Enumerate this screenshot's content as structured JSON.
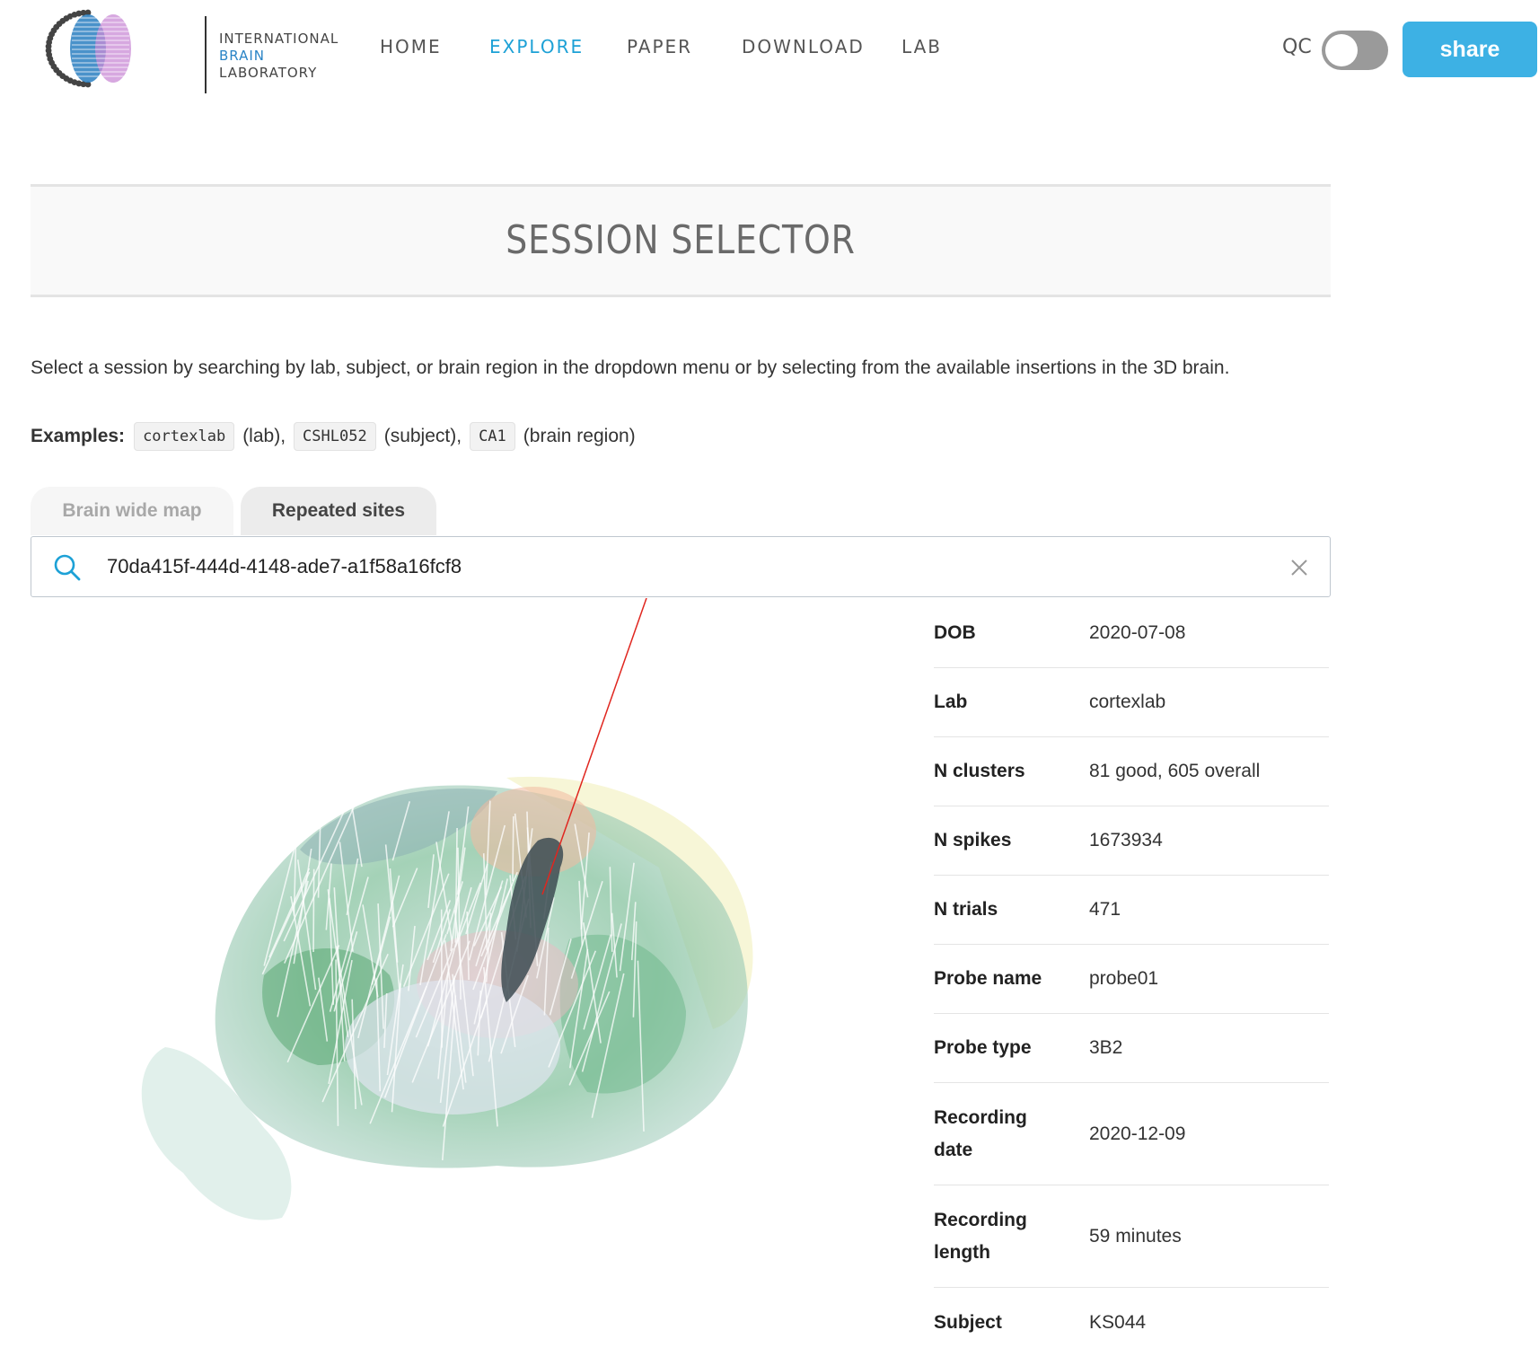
{
  "logo": {
    "line1": "INTERNATIONAL",
    "line2": "BRAIN",
    "line3": "LABORATORY"
  },
  "nav": {
    "items": [
      {
        "label": "HOME",
        "active": false
      },
      {
        "label": "EXPLORE",
        "active": true
      },
      {
        "label": "PAPER",
        "active": false
      },
      {
        "label": "DOWNLOAD",
        "active": false
      },
      {
        "label": "LAB",
        "active": false
      }
    ]
  },
  "header_controls": {
    "qc_label": "QC",
    "qc_enabled": false,
    "share_label": "share"
  },
  "page": {
    "title": "SESSION SELECTOR",
    "description": "Select a session by searching by lab, subject, or brain region in the dropdown menu or by selecting from the available insertions in the 3D brain.",
    "examples_label": "Examples:",
    "examples": [
      {
        "code": "cortexlab",
        "note": "(lab),"
      },
      {
        "code": "CSHL052",
        "note": "(subject),"
      },
      {
        "code": "CA1",
        "note": "(brain region)"
      }
    ]
  },
  "tabs": [
    {
      "label": "Brain wide map",
      "selected": false
    },
    {
      "label": "Repeated sites",
      "selected": true
    }
  ],
  "search": {
    "value": "70da415f-444d-4148-ade7-a1f58a16fcf8"
  },
  "session_info": [
    {
      "key": "DOB",
      "value": "2020-07-08"
    },
    {
      "key": "Lab",
      "value": "cortexlab"
    },
    {
      "key": "N clusters",
      "value": "81 good, 605 overall"
    },
    {
      "key": "N spikes",
      "value": "1673934"
    },
    {
      "key": "N trials",
      "value": "471"
    },
    {
      "key": "Probe name",
      "value": "probe01"
    },
    {
      "key": "Probe type",
      "value": "3B2"
    },
    {
      "key": "Recording date",
      "value": "2020-12-09"
    },
    {
      "key": "Recording length",
      "value": "59 minutes"
    },
    {
      "key": "Subject",
      "value": "KS044"
    }
  ],
  "colors": {
    "accent": "#1da1d6",
    "share_button": "#3db1e4",
    "toggle_off": "#9a9a9a",
    "probe_line": "#e0261f"
  },
  "icons": {
    "search": "search-icon",
    "clear": "close-icon"
  }
}
